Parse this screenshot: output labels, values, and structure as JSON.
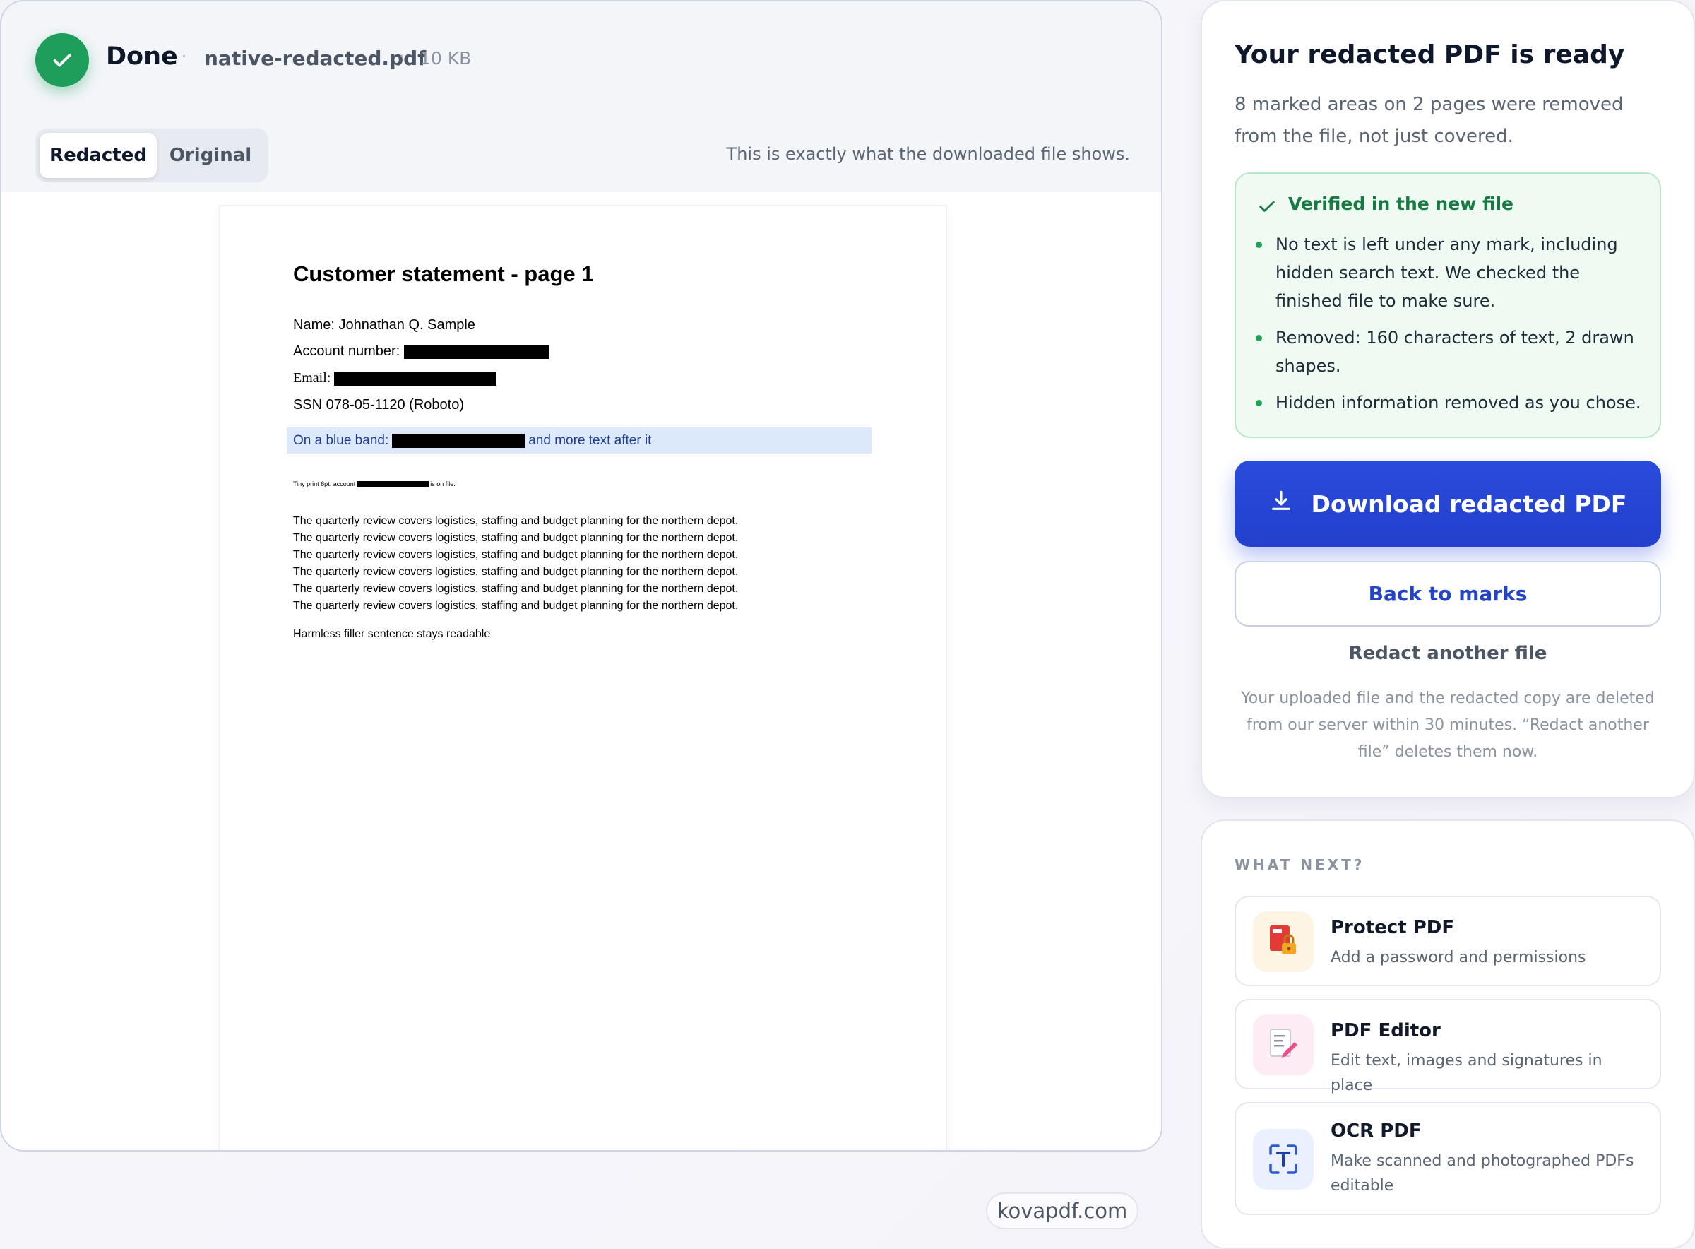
{
  "status": {
    "label": "Done",
    "file_name": "native-redacted.pdf",
    "file_size": "10 KB"
  },
  "preview": {
    "tabs": [
      {
        "label": "Redacted",
        "active": true
      },
      {
        "label": "Original",
        "active": false
      }
    ],
    "note": "This is exactly what the downloaded file shows.",
    "page": {
      "title": "Customer statement - page 1",
      "name_line": "Name: Johnathan Q. Sample",
      "account_label": "Account number:",
      "email_label": "Email:",
      "ssn_line": "SSN 078-05-1120 (Roboto)",
      "band_prefix": "On a blue band:",
      "band_suffix": "and more text after it",
      "tiny_prefix": "Tiny print 6pt: account",
      "tiny_suffix": "is on file.",
      "paragraph_lines": [
        "The quarterly review covers logistics, staffing and budget planning for the northern depot.",
        "The quarterly review covers logistics, staffing and budget planning for the northern depot.",
        "The quarterly review covers logistics, staffing and budget planning for the northern depot.",
        "The quarterly review covers logistics, staffing and budget planning for the northern depot.",
        "The quarterly review covers logistics, staffing and budget planning for the northern depot.",
        "The quarterly review covers logistics, staffing and budget planning for the northern depot."
      ],
      "closing_line": "Harmless filler sentence stays readable"
    }
  },
  "watermark": "kovapdf.com",
  "result": {
    "title": "Your redacted PDF is ready",
    "subtitle": "8 marked areas on 2 pages were removed from the file, not just covered.",
    "verified": {
      "title": "Verified in the new file",
      "items": [
        "No text is left under any mark, including hidden search text. We checked the finished file to make sure.",
        "Removed: 160 characters of text, 2 drawn shapes.",
        "Hidden information removed as you chose."
      ]
    },
    "download_label": "Download redacted PDF",
    "back_label": "Back to marks",
    "another_label": "Redact another file",
    "delete_note": "Your uploaded file and the redacted copy are deleted from our server within 30 minutes. “Redact another file” deletes them now."
  },
  "next": {
    "heading": "WHAT NEXT?",
    "tools": [
      {
        "name": "Protect PDF",
        "desc": "Add a password and permissions",
        "icon": "pdf-lock-icon"
      },
      {
        "name": "PDF Editor",
        "desc": "Edit text, images and signatures in place",
        "icon": "pdf-edit-icon"
      },
      {
        "name": "OCR PDF",
        "desc": "Make scanned and photographed PDFs editable",
        "icon": "ocr-scan-icon"
      }
    ]
  },
  "colors": {
    "success": "#1e9e5a",
    "primary": "#2443c6",
    "band": "#dbe9fb"
  }
}
